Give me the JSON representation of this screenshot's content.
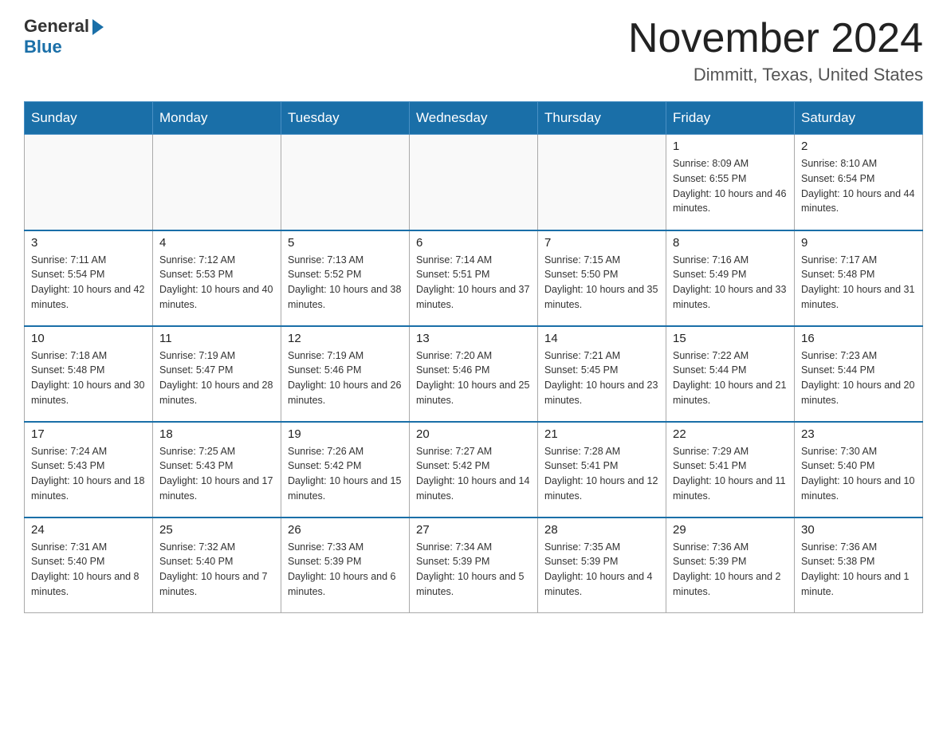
{
  "logo": {
    "text_general": "General",
    "text_blue": "Blue"
  },
  "header": {
    "month_year": "November 2024",
    "location": "Dimmitt, Texas, United States"
  },
  "weekdays": [
    "Sunday",
    "Monday",
    "Tuesday",
    "Wednesday",
    "Thursday",
    "Friday",
    "Saturday"
  ],
  "weeks": [
    [
      {
        "day": "",
        "info": ""
      },
      {
        "day": "",
        "info": ""
      },
      {
        "day": "",
        "info": ""
      },
      {
        "day": "",
        "info": ""
      },
      {
        "day": "",
        "info": ""
      },
      {
        "day": "1",
        "info": "Sunrise: 8:09 AM\nSunset: 6:55 PM\nDaylight: 10 hours and 46 minutes."
      },
      {
        "day": "2",
        "info": "Sunrise: 8:10 AM\nSunset: 6:54 PM\nDaylight: 10 hours and 44 minutes."
      }
    ],
    [
      {
        "day": "3",
        "info": "Sunrise: 7:11 AM\nSunset: 5:54 PM\nDaylight: 10 hours and 42 minutes."
      },
      {
        "day": "4",
        "info": "Sunrise: 7:12 AM\nSunset: 5:53 PM\nDaylight: 10 hours and 40 minutes."
      },
      {
        "day": "5",
        "info": "Sunrise: 7:13 AM\nSunset: 5:52 PM\nDaylight: 10 hours and 38 minutes."
      },
      {
        "day": "6",
        "info": "Sunrise: 7:14 AM\nSunset: 5:51 PM\nDaylight: 10 hours and 37 minutes."
      },
      {
        "day": "7",
        "info": "Sunrise: 7:15 AM\nSunset: 5:50 PM\nDaylight: 10 hours and 35 minutes."
      },
      {
        "day": "8",
        "info": "Sunrise: 7:16 AM\nSunset: 5:49 PM\nDaylight: 10 hours and 33 minutes."
      },
      {
        "day": "9",
        "info": "Sunrise: 7:17 AM\nSunset: 5:48 PM\nDaylight: 10 hours and 31 minutes."
      }
    ],
    [
      {
        "day": "10",
        "info": "Sunrise: 7:18 AM\nSunset: 5:48 PM\nDaylight: 10 hours and 30 minutes."
      },
      {
        "day": "11",
        "info": "Sunrise: 7:19 AM\nSunset: 5:47 PM\nDaylight: 10 hours and 28 minutes."
      },
      {
        "day": "12",
        "info": "Sunrise: 7:19 AM\nSunset: 5:46 PM\nDaylight: 10 hours and 26 minutes."
      },
      {
        "day": "13",
        "info": "Sunrise: 7:20 AM\nSunset: 5:46 PM\nDaylight: 10 hours and 25 minutes."
      },
      {
        "day": "14",
        "info": "Sunrise: 7:21 AM\nSunset: 5:45 PM\nDaylight: 10 hours and 23 minutes."
      },
      {
        "day": "15",
        "info": "Sunrise: 7:22 AM\nSunset: 5:44 PM\nDaylight: 10 hours and 21 minutes."
      },
      {
        "day": "16",
        "info": "Sunrise: 7:23 AM\nSunset: 5:44 PM\nDaylight: 10 hours and 20 minutes."
      }
    ],
    [
      {
        "day": "17",
        "info": "Sunrise: 7:24 AM\nSunset: 5:43 PM\nDaylight: 10 hours and 18 minutes."
      },
      {
        "day": "18",
        "info": "Sunrise: 7:25 AM\nSunset: 5:43 PM\nDaylight: 10 hours and 17 minutes."
      },
      {
        "day": "19",
        "info": "Sunrise: 7:26 AM\nSunset: 5:42 PM\nDaylight: 10 hours and 15 minutes."
      },
      {
        "day": "20",
        "info": "Sunrise: 7:27 AM\nSunset: 5:42 PM\nDaylight: 10 hours and 14 minutes."
      },
      {
        "day": "21",
        "info": "Sunrise: 7:28 AM\nSunset: 5:41 PM\nDaylight: 10 hours and 12 minutes."
      },
      {
        "day": "22",
        "info": "Sunrise: 7:29 AM\nSunset: 5:41 PM\nDaylight: 10 hours and 11 minutes."
      },
      {
        "day": "23",
        "info": "Sunrise: 7:30 AM\nSunset: 5:40 PM\nDaylight: 10 hours and 10 minutes."
      }
    ],
    [
      {
        "day": "24",
        "info": "Sunrise: 7:31 AM\nSunset: 5:40 PM\nDaylight: 10 hours and 8 minutes."
      },
      {
        "day": "25",
        "info": "Sunrise: 7:32 AM\nSunset: 5:40 PM\nDaylight: 10 hours and 7 minutes."
      },
      {
        "day": "26",
        "info": "Sunrise: 7:33 AM\nSunset: 5:39 PM\nDaylight: 10 hours and 6 minutes."
      },
      {
        "day": "27",
        "info": "Sunrise: 7:34 AM\nSunset: 5:39 PM\nDaylight: 10 hours and 5 minutes."
      },
      {
        "day": "28",
        "info": "Sunrise: 7:35 AM\nSunset: 5:39 PM\nDaylight: 10 hours and 4 minutes."
      },
      {
        "day": "29",
        "info": "Sunrise: 7:36 AM\nSunset: 5:39 PM\nDaylight: 10 hours and 2 minutes."
      },
      {
        "day": "30",
        "info": "Sunrise: 7:36 AM\nSunset: 5:38 PM\nDaylight: 10 hours and 1 minute."
      }
    ]
  ]
}
